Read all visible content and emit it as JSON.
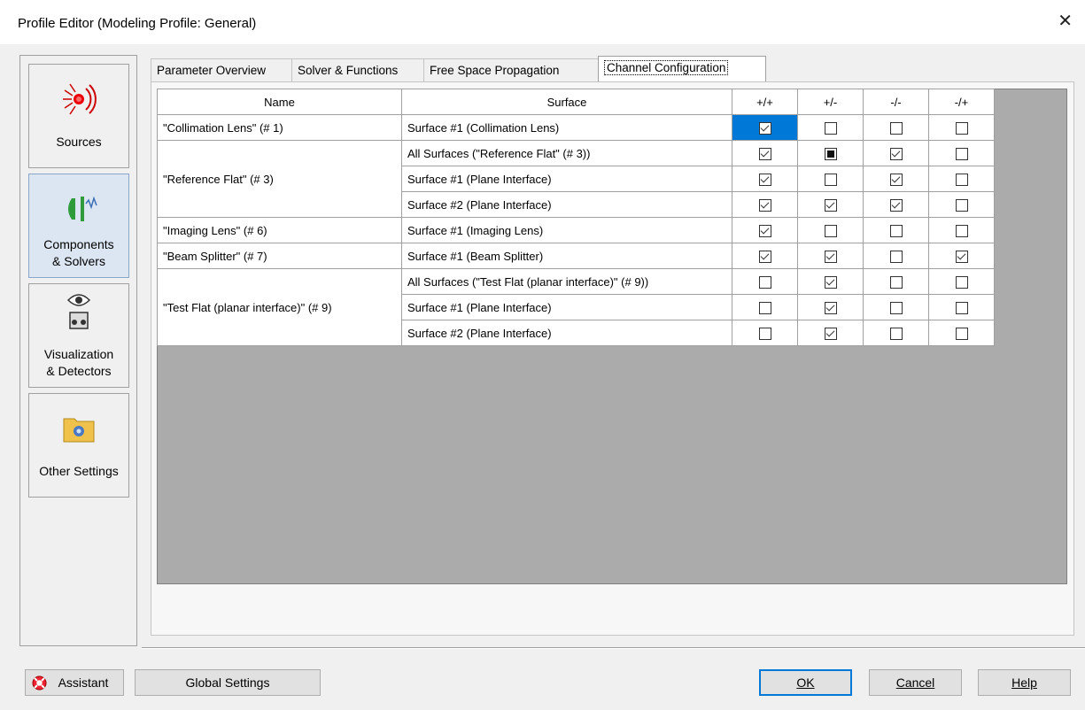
{
  "window": {
    "title": "Profile Editor (Modeling Profile: General)",
    "close_glyph": "✕"
  },
  "sidebar": {
    "items": [
      {
        "label_line1": "Sources",
        "label_line2": "",
        "icon": "sources-icon"
      },
      {
        "label_line1": "Components",
        "label_line2": "& Solvers",
        "icon": "components-solvers-icon"
      },
      {
        "label_line1": "Visualization",
        "label_line2": "& Detectors",
        "icon": "visualization-detectors-icon"
      },
      {
        "label_line1": "Other Settings",
        "label_line2": "",
        "icon": "other-settings-icon"
      }
    ]
  },
  "tabs": [
    "Parameter Overview",
    "Solver & Functions",
    "Free Space Propagation",
    "Channel Configuration"
  ],
  "table": {
    "headers": [
      "Name",
      "Surface",
      "+/+",
      "+/-",
      "-/-",
      "-/+"
    ],
    "rows": [
      {
        "name": "\"Collimation Lens\" (# 1)",
        "surface": "Surface #1 (Collimation Lens)",
        "checks": [
          "checked",
          "unchecked",
          "unchecked",
          "unchecked"
        ]
      },
      {
        "name": "\"Reference Flat\" (# 3)",
        "surface": "All Surfaces (\"Reference Flat\" (# 3))",
        "checks": [
          "checked",
          "indeterminate",
          "checked",
          "unchecked"
        ]
      },
      {
        "name": "",
        "surface": "Surface #1 (Plane Interface)",
        "checks": [
          "checked",
          "unchecked",
          "checked",
          "unchecked"
        ]
      },
      {
        "name": "",
        "surface": "Surface #2 (Plane Interface)",
        "checks": [
          "checked",
          "checked",
          "checked",
          "unchecked"
        ]
      },
      {
        "name": "\"Imaging Lens\" (# 6)",
        "surface": "Surface #1 (Imaging Lens)",
        "checks": [
          "checked",
          "unchecked",
          "unchecked",
          "unchecked"
        ]
      },
      {
        "name": "\"Beam Splitter\" (# 7)",
        "surface": "Surface #1 (Beam Splitter)",
        "checks": [
          "checked",
          "checked",
          "unchecked",
          "checked"
        ]
      },
      {
        "name": "\"Test Flat  (planar interface)\" (# 9)",
        "surface": "All Surfaces (\"Test Flat  (planar interface)\" (# 9))",
        "checks": [
          "unchecked",
          "checked",
          "unchecked",
          "unchecked"
        ]
      },
      {
        "name": "",
        "surface": "Surface #1 (Plane Interface)",
        "checks": [
          "unchecked",
          "checked",
          "unchecked",
          "unchecked"
        ]
      },
      {
        "name": "",
        "surface": "Surface #2 (Plane Interface)",
        "checks": [
          "unchecked",
          "checked",
          "unchecked",
          "unchecked"
        ]
      }
    ]
  },
  "buttons": {
    "assistant": "Assistant",
    "global_settings": "Global Settings",
    "ok": "OK",
    "cancel": "Cancel",
    "help": "Help"
  },
  "colors": {
    "selection": "#0078d7",
    "grid_background": "#ababab",
    "active_sidebar": "#dce6f3"
  }
}
